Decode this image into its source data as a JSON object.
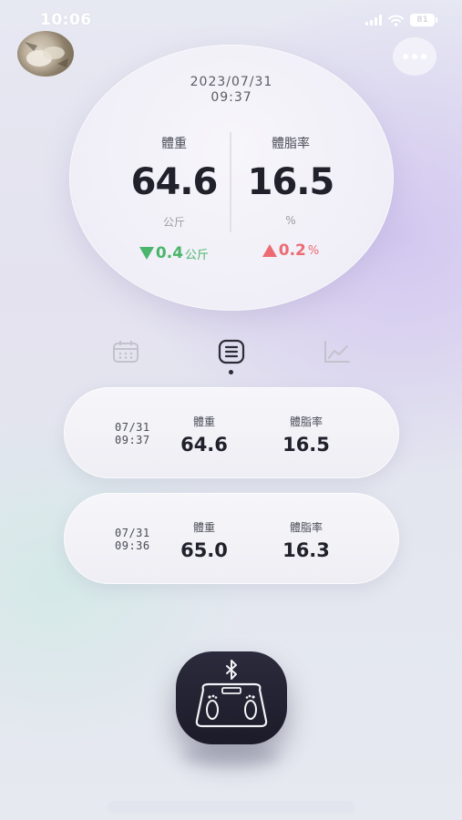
{
  "status_bar": {
    "time": "10:06",
    "battery": "81",
    "icons": [
      "signal-icon",
      "wifi-icon",
      "battery-icon"
    ]
  },
  "header": {
    "avatar": "avatar",
    "menu_icon": "more-icon"
  },
  "summary": {
    "date": "2023/07/31",
    "time": "09:37",
    "weight": {
      "label": "體重",
      "value": "64.6",
      "unit": "公斤",
      "change": "0.4",
      "change_unit": "公斤",
      "direction": "down"
    },
    "body_fat": {
      "label": "體脂率",
      "value": "16.5",
      "unit": "%",
      "change": "0.2",
      "change_unit": "%",
      "direction": "up"
    }
  },
  "tabs": [
    {
      "icon": "calendar-icon",
      "active": false
    },
    {
      "icon": "list-icon",
      "active": true
    },
    {
      "icon": "chart-icon",
      "active": false
    }
  ],
  "records": [
    {
      "date": "07/31",
      "time": "09:37",
      "weight_label": "體重",
      "weight": "64.6",
      "fat_label": "體脂率",
      "fat": "16.5"
    },
    {
      "date": "07/31",
      "time": "09:36",
      "weight_label": "體重",
      "weight": "65.0",
      "fat_label": "體脂率",
      "fat": "16.3"
    }
  ],
  "colors": {
    "decrease": "#4ab56b",
    "increase": "#ec6b72",
    "scale_button": "#1f1f2e"
  },
  "scale_button": {
    "icons": [
      "bluetooth-icon",
      "scale-icon"
    ]
  }
}
